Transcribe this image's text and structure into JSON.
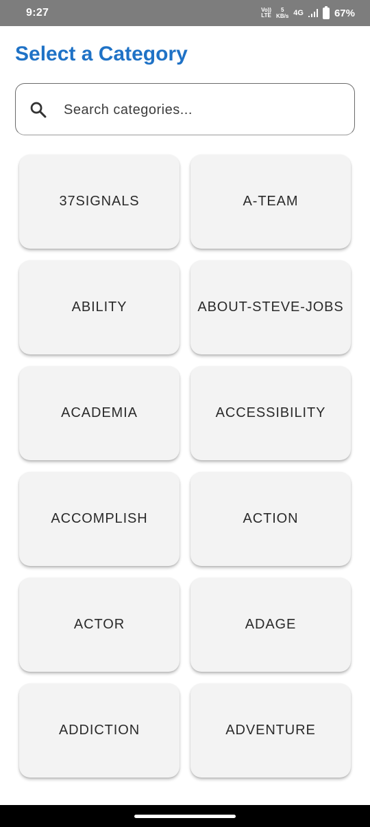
{
  "status_bar": {
    "time": "9:27",
    "volte_top": "Vo))",
    "volte_bottom": "LTE",
    "speed_value": "5",
    "speed_unit": "KB/s",
    "network": "4G",
    "battery": "67%"
  },
  "page": {
    "title": "Select a Category",
    "title_color": "#1f72c6"
  },
  "search": {
    "placeholder": "Search categories...",
    "value": "",
    "icon": "search-icon"
  },
  "categories": [
    "37SIGNALS",
    "A-TEAM",
    "ABILITY",
    "ABOUT-STEVE-JOBS",
    "ACADEMIA",
    "ACCESSIBILITY",
    "ACCOMPLISH",
    "ACTION",
    "ACTOR",
    "ADAGE",
    "ADDICTION",
    "ADVENTURE"
  ]
}
